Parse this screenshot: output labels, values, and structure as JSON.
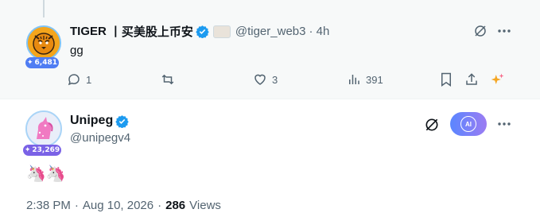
{
  "reply": {
    "author_name": "TIGER",
    "author_name_cn": "丨买美股上币安",
    "handle": "@tiger_web3",
    "time": "· 4h",
    "text": "gg",
    "badge_count": "6,481",
    "actions": {
      "replies": "1",
      "reposts": "",
      "likes": "3",
      "views": "391"
    }
  },
  "post": {
    "author_name": "Unipeg",
    "handle": "@unipegv4",
    "badge_count": "23,269",
    "text": "🦄🦄",
    "time": "2:38 PM",
    "date": "Aug 10, 2026",
    "views_count": "286",
    "views_label": "Views",
    "sep1": "·",
    "sep2": "·",
    "grok_label": "AI"
  },
  "colors": {
    "verified": "#1d9bf0",
    "text_secondary": "#536471",
    "grok_gradient_start": "#5a86ff",
    "grok_gradient_end": "#9b7cf2"
  }
}
